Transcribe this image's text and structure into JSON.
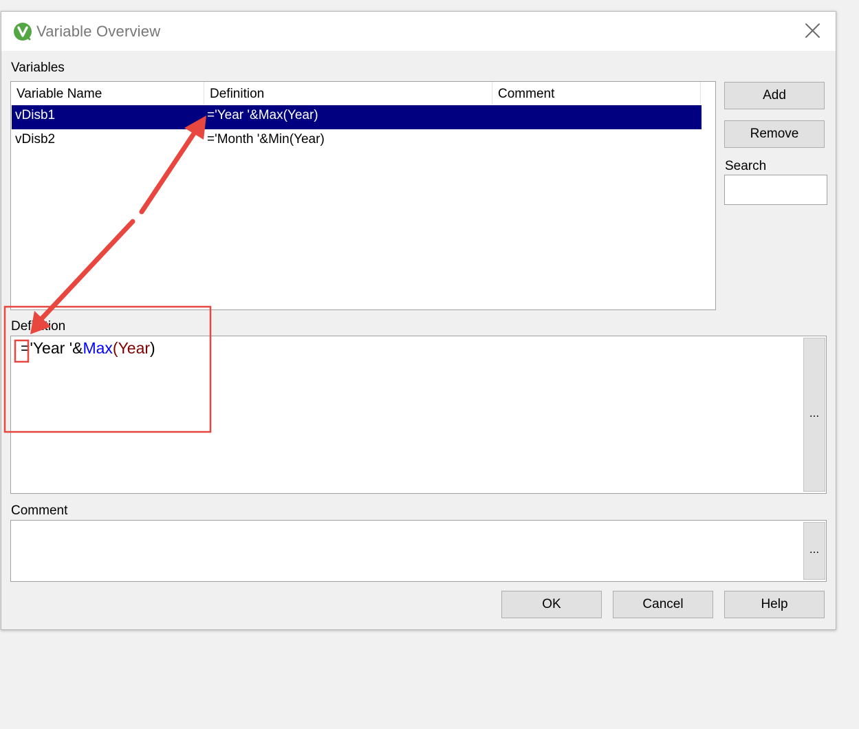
{
  "window": {
    "title": "Variable Overview",
    "logo_letter": "V",
    "logo_color": "#54a645"
  },
  "variables_label": "Variables",
  "table": {
    "columns": [
      "Variable Name",
      "Definition",
      "Comment"
    ],
    "rows": [
      {
        "name": "vDisb1",
        "definition": "='Year '&Max(Year)",
        "comment": "",
        "selected": true
      },
      {
        "name": "vDisb2",
        "definition": "='Month '&Min(Year)",
        "comment": "",
        "selected": false
      }
    ],
    "selection_color": "#000080"
  },
  "buttons": {
    "add": "Add",
    "remove": "Remove",
    "ok": "OK",
    "cancel": "Cancel",
    "help": "Help"
  },
  "search": {
    "label": "Search",
    "value": ""
  },
  "definition": {
    "label": "Definition",
    "value_tokens": {
      "op": "=",
      "string": "'Year '",
      "amp": "&",
      "func": "Max",
      "open": "(",
      "field": "Year",
      "close": ")"
    },
    "ellipsis": "..."
  },
  "comment": {
    "label": "Comment",
    "value": "",
    "ellipsis": "..."
  },
  "annotation": {
    "color": "#e8473f"
  }
}
